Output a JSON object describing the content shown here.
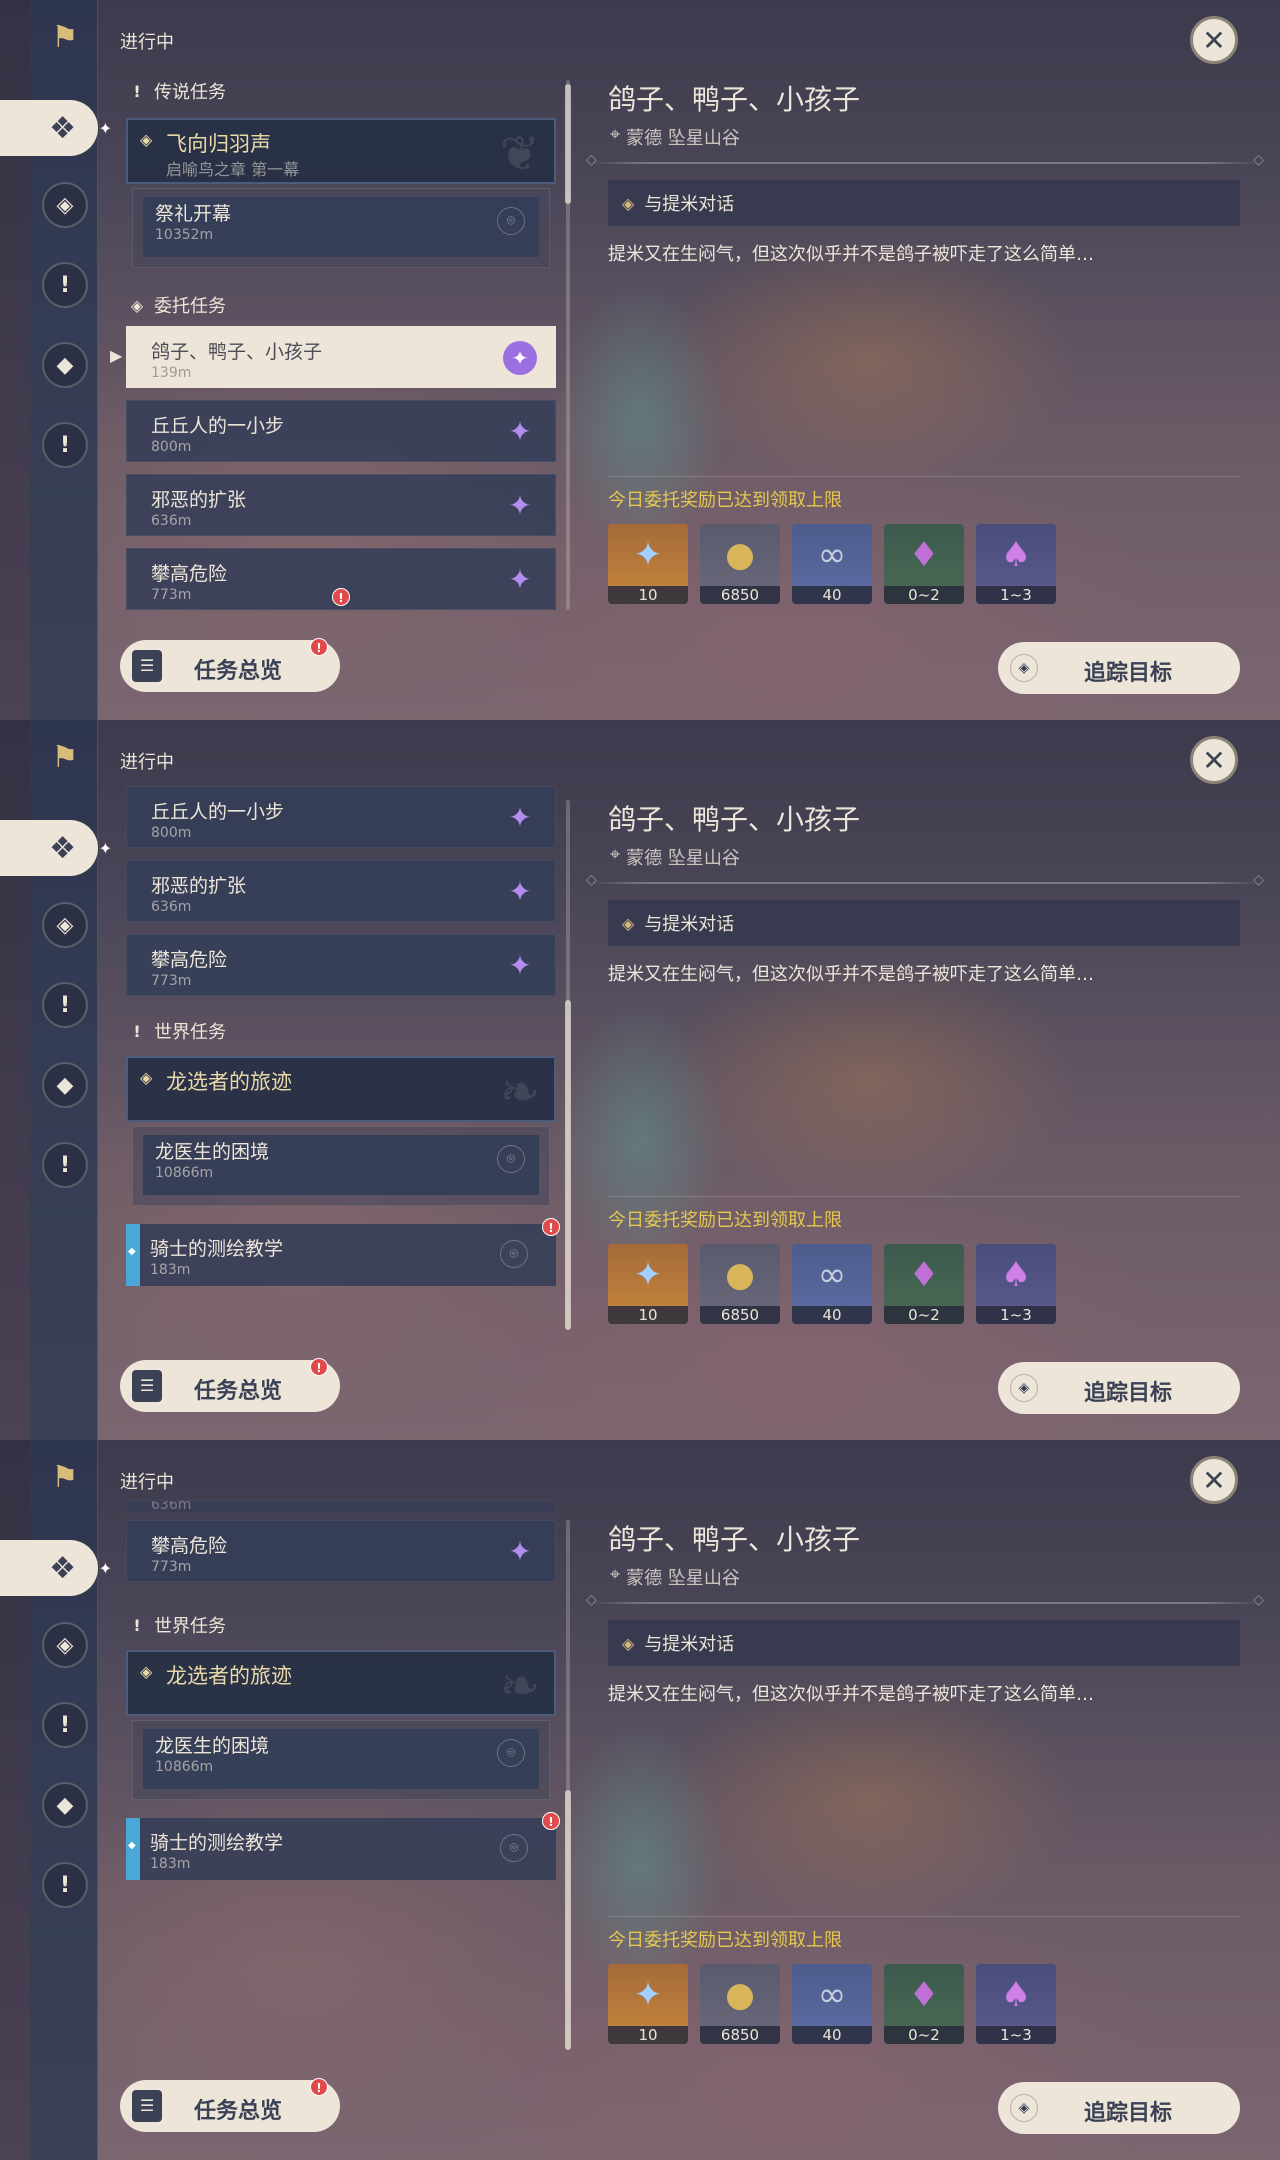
{
  "status_label": "进行中",
  "close_symbol": "✕",
  "sections": {
    "legend": "传说任务",
    "commission": "委托任务",
    "world": "世界任务"
  },
  "legend_quest": {
    "title": "飞向归羽声",
    "subtitle": "启喻鸟之章 第一幕",
    "step_title": "祭礼开幕",
    "step_distance": "10352m"
  },
  "commissions": [
    {
      "title": "鸽子、鸭子、小孩子",
      "distance": "139m"
    },
    {
      "title": "丘丘人的一小步",
      "distance": "800m"
    },
    {
      "title": "邪恶的扩张",
      "distance": "636m"
    },
    {
      "title": "攀高危险",
      "distance": "773m"
    }
  ],
  "commission_partial_distance": "636m",
  "world_quest": {
    "title": "龙选者的旅迹",
    "step_title": "龙医生的困境",
    "step_distance": "10866m"
  },
  "world_quest_2": {
    "title": "骑士的测绘教学",
    "distance": "183m"
  },
  "overview_button": "任务总览",
  "track_button": "追踪目标",
  "alert_mark": "!",
  "detail": {
    "title": "鸽子、鸭子、小孩子",
    "location": "蒙德 坠星山谷",
    "objective": "与提米对话",
    "description": "提米又在生闷气，但这次似乎并不是鸽子被吓走了这么简单…",
    "reward_note": "今日委托奖励已达到领取上限",
    "rewards": [
      {
        "icon": "primogem-icon",
        "qty": "10"
      },
      {
        "icon": "mora-icon",
        "qty": "6850"
      },
      {
        "icon": "companionship-exp-icon",
        "qty": "40"
      },
      {
        "icon": "crystal-icon",
        "qty": "0~2"
      },
      {
        "icon": "crystal-cluster-icon",
        "qty": "1~3"
      }
    ]
  }
}
